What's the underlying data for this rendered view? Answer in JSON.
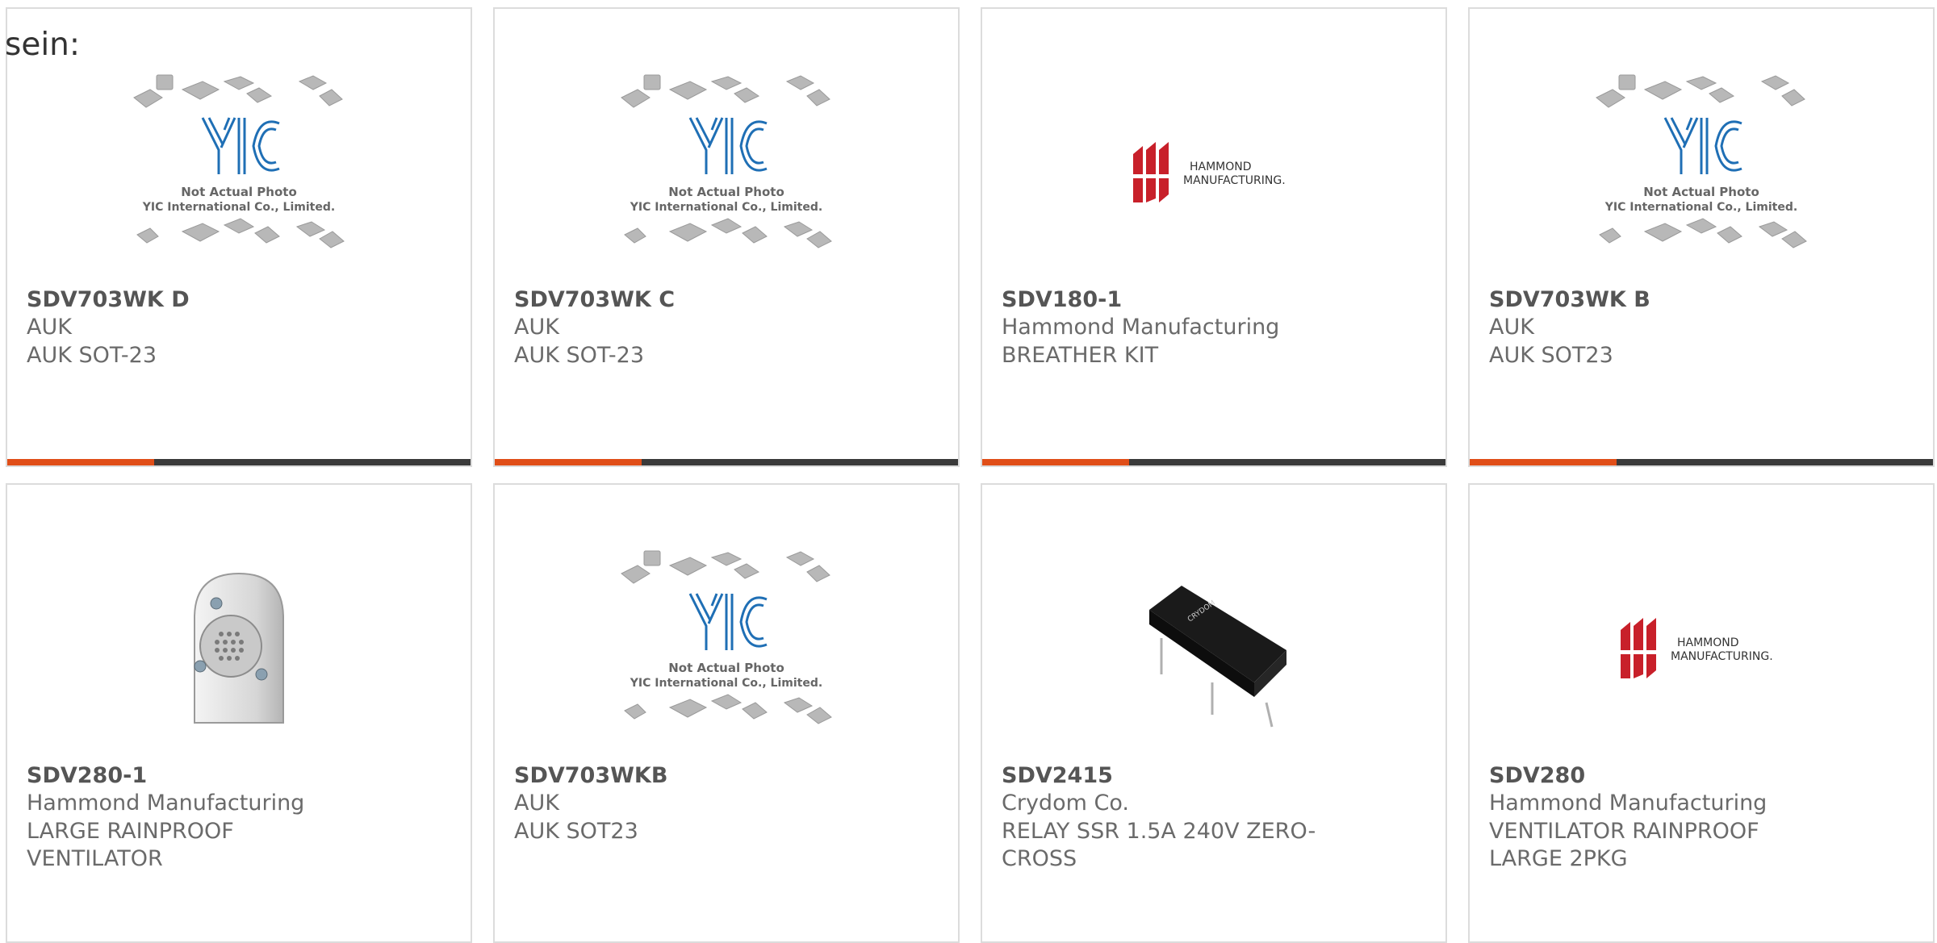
{
  "heading": "sein:",
  "placeholder": {
    "line1": "Not Actual Photo",
    "line2": "YIC International Co., Limited."
  },
  "hammond_logo": {
    "line1": "HAMMOND",
    "line2": "MANUFACTURING."
  },
  "products": [
    {
      "part": "SDV703WK D",
      "manufacturer": "AUK",
      "description": "AUK SOT-23",
      "image": "yic-placeholder"
    },
    {
      "part": "SDV703WK C",
      "manufacturer": "AUK",
      "description": "AUK SOT-23",
      "image": "yic-placeholder"
    },
    {
      "part": "SDV180-1",
      "manufacturer": "Hammond Manufacturing",
      "description": "BREATHER KIT",
      "image": "hammond-logo"
    },
    {
      "part": "SDV703WK B",
      "manufacturer": "AUK",
      "description": "AUK SOT23",
      "image": "yic-placeholder"
    },
    {
      "part": "SDV280-1",
      "manufacturer": "Hammond Manufacturing",
      "description": "LARGE RAINPROOF VENTILATOR",
      "image": "ventilator-photo"
    },
    {
      "part": "SDV703WKB",
      "manufacturer": "AUK",
      "description": "AUK SOT23",
      "image": "yic-placeholder"
    },
    {
      "part": "SDV2415",
      "manufacturer": "Crydom Co.",
      "description": "RELAY SSR 1.5A 240V ZERO-CROSS",
      "image": "relay-photo"
    },
    {
      "part": "SDV280",
      "manufacturer": "Hammond Manufacturing",
      "description": "VENTILATOR RAINPROOF LARGE 2PKG",
      "image": "hammond-logo"
    }
  ],
  "colors": {
    "accent": "#e04e18",
    "bar": "#3a3a3a",
    "yic_blue": "#1f6fb5",
    "hammond_red": "#c8202a"
  }
}
